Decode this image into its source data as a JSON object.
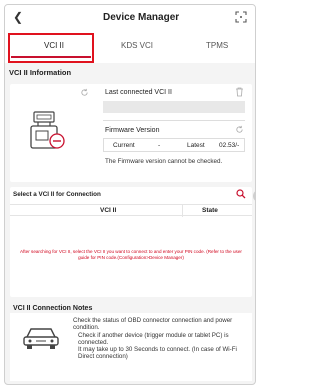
{
  "header": {
    "back_icon": "chevron-left-icon",
    "title": "Device Manager",
    "expand_icon": "fullscreen-icon"
  },
  "tabs": [
    {
      "label": "VCI II",
      "selected": true
    },
    {
      "label": "KDS VCI",
      "selected": false
    },
    {
      "label": "TPMS",
      "selected": false
    }
  ],
  "highlight_color": "#e0121e",
  "accent": "#c8102e",
  "info": {
    "section_label": "VCI II Information",
    "last_connected_label": "Last connected VCI II",
    "last_connected_value": "",
    "firmware_label": "Firmware Version",
    "current_label": "Current",
    "current_value": "-",
    "latest_label": "Latest",
    "latest_value": "02.53/-",
    "firmware_message": "The Firmware version cannot be checked."
  },
  "select": {
    "title": "Select a VCI II for Connection",
    "columns": [
      "VCI II",
      "State"
    ],
    "message": "After searching for VCI II, select the VCI II you want to connect to and enter your PIN code. (Refer to the user guide for PIN code.(Configuration>Device Manager)"
  },
  "notes": {
    "title": "VCI II Connection Notes",
    "lines": [
      "Check the status of OBD connector connection and power condition.",
      "Check if another device (trigger module or tablet PC) is connected.",
      "It may take up to 30 Seconds to connect. (In case of Wi-Fi Direct connection)"
    ]
  }
}
